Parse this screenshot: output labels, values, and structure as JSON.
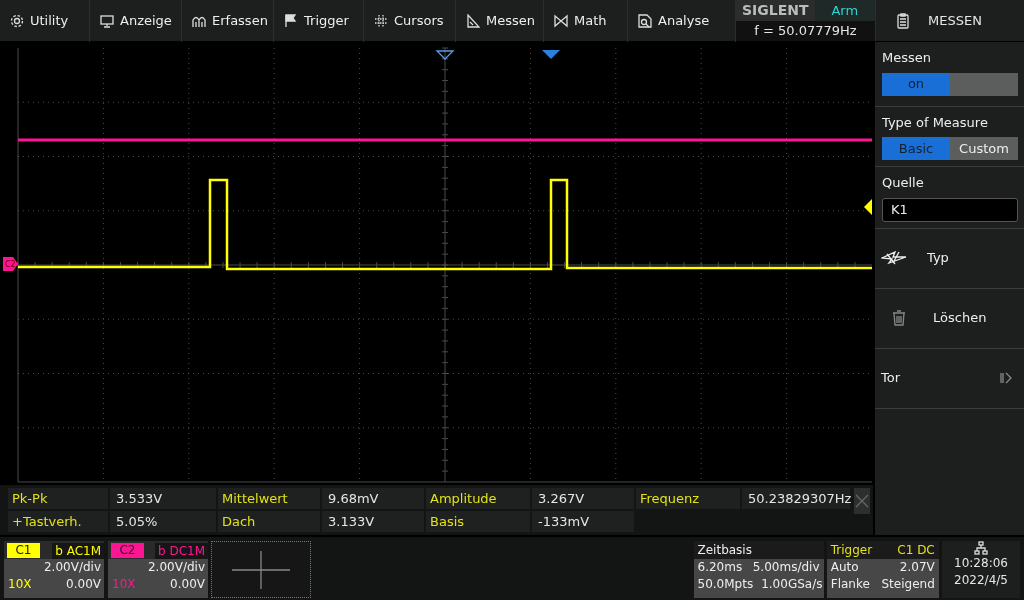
{
  "menu": [
    {
      "label": "Utility"
    },
    {
      "label": "Anzeige"
    },
    {
      "label": "Erfassen"
    },
    {
      "label": "Trigger"
    },
    {
      "label": "Cursors"
    },
    {
      "label": "Messen"
    },
    {
      "label": "Math"
    },
    {
      "label": "Analyse"
    }
  ],
  "status": {
    "brand": "SIGLENT",
    "state": "Arm",
    "frequency": "f = 50.07779Hz"
  },
  "scope": {
    "channel_marker": "C2"
  },
  "side_menu": {
    "title": "MESSEN",
    "items": [
      {
        "kind": "toggle",
        "label": "Messen",
        "value": "on",
        "on": true
      },
      {
        "kind": "segmented",
        "label": "Type of Measure",
        "options": [
          {
            "label": "Basic",
            "selected": true
          },
          {
            "label": "Custom",
            "selected": false
          }
        ]
      },
      {
        "kind": "field",
        "label": "Quelle",
        "value": "K1"
      },
      {
        "kind": "action",
        "label": "Typ"
      },
      {
        "kind": "action",
        "label": "Löschen"
      },
      {
        "kind": "action",
        "label": "Tor"
      }
    ]
  },
  "measurements": [
    {
      "label": "Pk-Pk",
      "value": "3.533V"
    },
    {
      "label": "Mittelwert",
      "value": "9.68mV"
    },
    {
      "label": "Amplitude",
      "value": "3.267V"
    },
    {
      "label": "Frequenz",
      "value": "50.23829307Hz"
    },
    {
      "label": "+Tastverh.",
      "value": "5.05%"
    },
    {
      "label": "Dach",
      "value": "3.133V"
    },
    {
      "label": "Basis",
      "value": "-133mV"
    }
  ],
  "channels": [
    {
      "name": "C1",
      "color": "#ffff00",
      "coupling": "b AC1M",
      "scale": "2.00V/div",
      "probe": "10X",
      "offset": "0.00V"
    },
    {
      "name": "C2",
      "color": "#ff1493",
      "coupling": "b DC1M",
      "scale": "2.00V/div",
      "probe": "10X",
      "offset": "0.00V"
    }
  ],
  "timebase": {
    "title": "Zeitbasis",
    "delay": "6.20ms",
    "scale": "5.00ms/div",
    "memory": "50.0Mpts",
    "sample_rate": "1.00GSa/s"
  },
  "trigger": {
    "title": "Trigger",
    "source": "C1",
    "coupling": "DC",
    "mode": "Auto",
    "level": "2.07V",
    "type": "Flanke",
    "slope": "Steigend"
  },
  "clock": {
    "time": "10:28:06",
    "date": "2022/4/5"
  }
}
